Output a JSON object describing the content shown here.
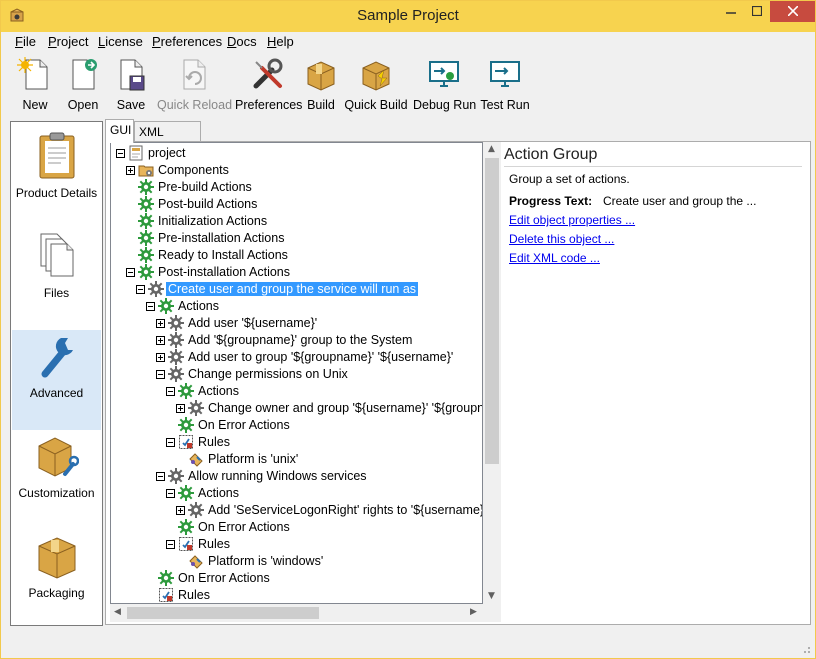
{
  "window": {
    "title": "Sample Project"
  },
  "menu": [
    "File",
    "Project",
    "License",
    "Preferences",
    "Docs",
    "Help"
  ],
  "toolbar": [
    {
      "label": "New",
      "icon": "new-file-icon",
      "enabled": true
    },
    {
      "label": "Open",
      "icon": "open-file-icon",
      "enabled": true
    },
    {
      "label": "Save",
      "icon": "save-file-icon",
      "enabled": true
    },
    {
      "label": "Quick Reload",
      "icon": "reload-icon",
      "enabled": false
    },
    {
      "label": "Preferences",
      "icon": "wrench-screwdriver-icon",
      "enabled": true
    },
    {
      "label": "Build",
      "icon": "package-icon",
      "enabled": true
    },
    {
      "label": "Quick Build",
      "icon": "quick-package-icon",
      "enabled": true
    },
    {
      "label": "Debug Run",
      "icon": "monitor-bug-icon",
      "enabled": true
    },
    {
      "label": "Test Run",
      "icon": "monitor-run-icon",
      "enabled": true
    }
  ],
  "sidebar": [
    {
      "label": "Product Details",
      "icon": "clipboard-icon",
      "active": false
    },
    {
      "label": "Files",
      "icon": "files-icon",
      "active": false
    },
    {
      "label": "Advanced",
      "icon": "wrench-icon",
      "active": true
    },
    {
      "label": "Customization",
      "icon": "box-wrench-icon",
      "active": false
    },
    {
      "label": "Packaging",
      "icon": "box-icon",
      "active": false
    }
  ],
  "tabs": [
    {
      "label": "GUI",
      "active": true
    },
    {
      "label": "XML Editor",
      "active": false
    }
  ],
  "tree": [
    {
      "label": "project",
      "depth": 0,
      "toggle": "minus",
      "icon": "project-icon"
    },
    {
      "label": "Components",
      "depth": 1,
      "toggle": "plus",
      "icon": "folder-gear-icon"
    },
    {
      "label": "Pre-build Actions",
      "depth": 1,
      "toggle": "none",
      "icon": "green-gear-icon"
    },
    {
      "label": "Post-build Actions",
      "depth": 1,
      "toggle": "none",
      "icon": "green-gear-icon"
    },
    {
      "label": "Initialization Actions",
      "depth": 1,
      "toggle": "none",
      "icon": "green-gear-icon"
    },
    {
      "label": "Pre-installation Actions",
      "depth": 1,
      "toggle": "none",
      "icon": "green-gear-icon"
    },
    {
      "label": "Ready to Install Actions",
      "depth": 1,
      "toggle": "none",
      "icon": "green-gear-icon"
    },
    {
      "label": "Post-installation Actions",
      "depth": 1,
      "toggle": "minus",
      "icon": "green-gear-icon"
    },
    {
      "label": "Create user and group the service will run as",
      "depth": 2,
      "toggle": "minus",
      "icon": "gray-gear-icon",
      "selected": true
    },
    {
      "label": "Actions",
      "depth": 3,
      "toggle": "minus",
      "icon": "green-gear-icon"
    },
    {
      "label": "Add user '${username}'",
      "depth": 4,
      "toggle": "plus",
      "icon": "gray-gear-icon"
    },
    {
      "label": "Add '${groupname}' group to the System",
      "depth": 4,
      "toggle": "plus",
      "icon": "gray-gear-icon"
    },
    {
      "label": "Add user to group '${groupname}' '${username}'",
      "depth": 4,
      "toggle": "plus",
      "icon": "gray-gear-icon"
    },
    {
      "label": "Change permissions on Unix",
      "depth": 4,
      "toggle": "minus",
      "icon": "gray-gear-icon"
    },
    {
      "label": "Actions",
      "depth": 5,
      "toggle": "minus",
      "icon": "green-gear-icon"
    },
    {
      "label": "Change owner and group '${username}' '${groupn",
      "depth": 6,
      "toggle": "plus",
      "icon": "gray-gear-icon"
    },
    {
      "label": "On Error Actions",
      "depth": 5,
      "toggle": "none",
      "icon": "green-gear-icon"
    },
    {
      "label": "Rules",
      "depth": 5,
      "toggle": "minus",
      "icon": "rules-icon"
    },
    {
      "label": "Platform is 'unix'",
      "depth": 6,
      "toggle": "none",
      "icon": "rule-item-icon"
    },
    {
      "label": "Allow running Windows services",
      "depth": 4,
      "toggle": "minus",
      "icon": "gray-gear-icon"
    },
    {
      "label": "Actions",
      "depth": 5,
      "toggle": "minus",
      "icon": "green-gear-icon"
    },
    {
      "label": "Add 'SeServiceLogonRight' rights to '${username}'",
      "depth": 6,
      "toggle": "plus",
      "icon": "gray-gear-icon"
    },
    {
      "label": "On Error Actions",
      "depth": 5,
      "toggle": "none",
      "icon": "green-gear-icon"
    },
    {
      "label": "Rules",
      "depth": 5,
      "toggle": "minus",
      "icon": "rules-icon"
    },
    {
      "label": "Platform is 'windows'",
      "depth": 6,
      "toggle": "none",
      "icon": "rule-item-icon"
    },
    {
      "label": "On Error Actions",
      "depth": 3,
      "toggle": "none",
      "icon": "green-gear-icon"
    },
    {
      "label": "Rules",
      "depth": 3,
      "toggle": "none",
      "icon": "rules-icon"
    }
  ],
  "props": {
    "title": "Action Group",
    "description": "Group a set of actions.",
    "progress_label": "Progress Text:",
    "progress_value": "Create user and group the ...",
    "links": [
      "Edit object properties ...",
      "Delete this object ...",
      "Edit XML code ..."
    ]
  },
  "colors": {
    "titlebar": "#f7d34f",
    "close_button": "#c74b3f",
    "selection": "#3399ff",
    "link": "#0000ee",
    "active_sidebar": "#d9e8f7"
  }
}
